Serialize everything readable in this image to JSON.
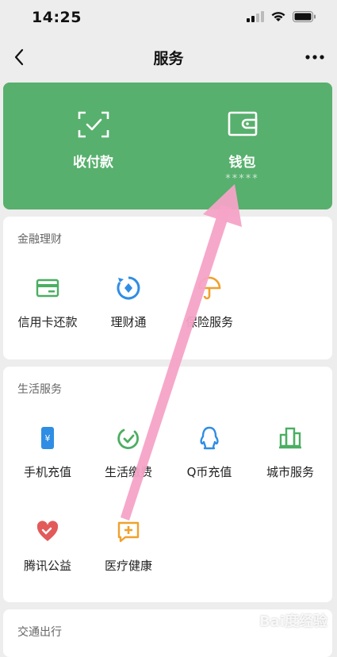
{
  "status": {
    "time": "14:25"
  },
  "nav": {
    "title": "服务"
  },
  "wallet_card": {
    "items": [
      {
        "label": "收付款",
        "sub": ""
      },
      {
        "label": "钱包",
        "sub": "*****"
      }
    ]
  },
  "finance": {
    "title": "金融理财",
    "items": [
      {
        "label": "信用卡还款",
        "icon": "credit-card-icon",
        "color": "#4cae62"
      },
      {
        "label": "理财通",
        "icon": "wealth-icon",
        "color": "#2f8de4"
      },
      {
        "label": "保险服务",
        "icon": "umbrella-icon",
        "color": "#f0a12c"
      }
    ]
  },
  "life": {
    "title": "生活服务",
    "items": [
      {
        "label": "手机充值",
        "icon": "phone-recharge-icon",
        "color": "#2f8de4"
      },
      {
        "label": "生活缴费",
        "icon": "utility-payment-icon",
        "color": "#4cae62"
      },
      {
        "label": "Q币充值",
        "icon": "qq-coin-icon",
        "color": "#2f8de4"
      },
      {
        "label": "城市服务",
        "icon": "city-building-icon",
        "color": "#4cae62"
      },
      {
        "label": "腾讯公益",
        "icon": "charity-heart-icon",
        "color": "#e25a5a"
      },
      {
        "label": "医疗健康",
        "icon": "medical-icon",
        "color": "#f0a12c"
      }
    ]
  },
  "transport": {
    "title": "交通出行"
  },
  "watermark": "Bai度经验"
}
